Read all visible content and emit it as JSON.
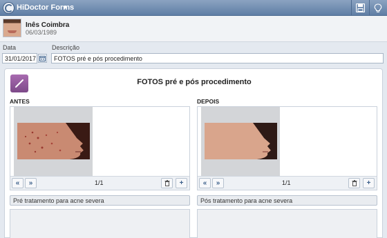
{
  "app": {
    "title": "HiDoctor Forms"
  },
  "patient": {
    "name": "Inês Coimbra",
    "dob": "06/03/1989"
  },
  "form": {
    "date_label": "Data",
    "date_value": "31/01/2017",
    "description_label": "Descrição",
    "description_value": "FOTOS pré e pós procedimento"
  },
  "panel": {
    "title": "FOTOS pré e pós procedimento",
    "before": {
      "label": "ANTES",
      "pager": "1/1",
      "caption": "Pré tratamento para acne severa"
    },
    "after": {
      "label": "DEPOIS",
      "pager": "1/1",
      "caption": "Pós tratamento para acne severa"
    }
  },
  "colors": {
    "topbar": "#6f8cb3",
    "accent": "#3b5f8a",
    "edit_button": "#8e56a0"
  }
}
